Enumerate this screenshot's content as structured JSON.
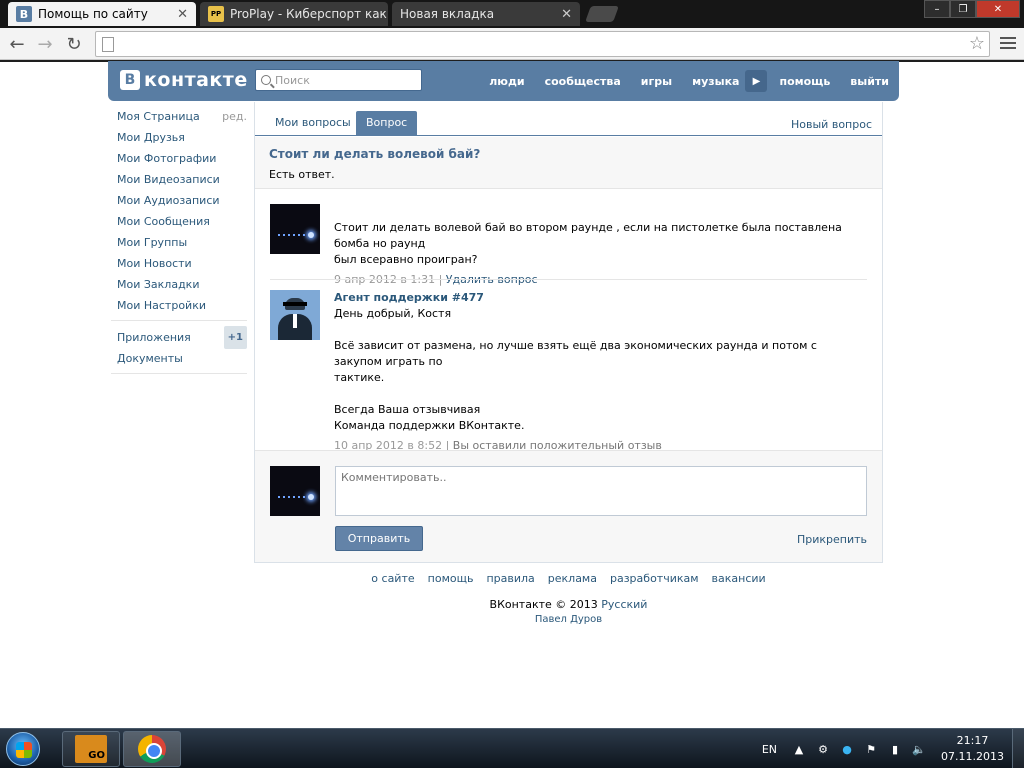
{
  "browser": {
    "tabs": [
      {
        "title": "Помощь по сайту",
        "favicon": "В"
      },
      {
        "title": "ProPlay - Киберспорт как",
        "favicon": "PP"
      },
      {
        "title": "Новая вкладка",
        "favicon": ""
      }
    ],
    "address": "",
    "window_buttons": {
      "minimize": "–",
      "maximize": "❐",
      "close": "✕"
    }
  },
  "vk": {
    "logo_letter": "В",
    "logo_text": "контакте",
    "search_placeholder": "Поиск",
    "nav": [
      "люди",
      "сообщества",
      "игры",
      "музыка",
      "помощь",
      "выйти"
    ],
    "sidebar": {
      "items": [
        {
          "label": "Моя Страница",
          "extra": "ред."
        },
        {
          "label": "Мои Друзья"
        },
        {
          "label": "Мои Фотографии"
        },
        {
          "label": "Мои Видеозаписи"
        },
        {
          "label": "Мои Аудиозаписи"
        },
        {
          "label": "Мои Сообщения"
        },
        {
          "label": "Мои Группы"
        },
        {
          "label": "Мои Новости"
        },
        {
          "label": "Мои Закладки"
        },
        {
          "label": "Мои Настройки"
        }
      ],
      "apps": {
        "label": "Приложения",
        "badge": "+1"
      },
      "docs": {
        "label": "Документы"
      }
    },
    "tabs": {
      "my_questions": "Мои вопросы",
      "question": "Вопрос",
      "new_question": "Новый вопрос"
    },
    "question": {
      "title": "Стоит ли делать волевой бай?",
      "status": "Есть ответ."
    },
    "posts": [
      {
        "author": "",
        "text_lines": [
          "Стоит ли делать волевой бай во втором раунде , если на пистолетке была поставлена бомба но раунд",
          "был всеравно проигран?"
        ],
        "date": "9 апр 2012 в 1:31",
        "action": "Удалить вопрос"
      },
      {
        "author": "Агент поддержки #477",
        "text_lines": [
          "День добрый, Костя",
          "",
          "Всё зависит от размена, но лучше взять ещё два экономических раунда и потом с закупом играть по",
          "тактике.",
          "",
          "Всегда Ваша отзывчивая",
          "Команда поддержки ВКонтакте."
        ],
        "date": "10 апр 2012 в 8:52",
        "action": "Вы оставили положительный отзыв"
      }
    ],
    "reply": {
      "placeholder": "Комментировать..",
      "send": "Отправить",
      "attach": "Прикрепить"
    },
    "footer": {
      "links": [
        "о сайте",
        "помощь",
        "правила",
        "реклама",
        "разработчикам",
        "вакансии"
      ],
      "copyright": "ВКонтакте © 2013",
      "language": "Русский",
      "author": "Павел Дуров"
    },
    "colors": {
      "header": "#597da3",
      "link": "#2b587a",
      "button": "#6383a8"
    }
  },
  "taskbar": {
    "apps": [
      "csgo-icon",
      "chrome-icon"
    ],
    "lang": "EN",
    "time": "21:17",
    "date": "07.11.2013"
  }
}
